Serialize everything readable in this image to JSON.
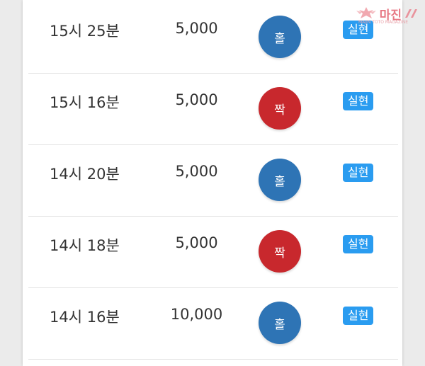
{
  "rows": [
    {
      "time": "15시 25분",
      "amount": "5,000",
      "result": "홀",
      "result_type": "odd",
      "status": "실현"
    },
    {
      "time": "15시 16분",
      "amount": "5,000",
      "result": "짝",
      "result_type": "even",
      "status": "실현"
    },
    {
      "time": "14시 20분",
      "amount": "5,000",
      "result": "홀",
      "result_type": "odd",
      "status": "실현"
    },
    {
      "time": "14시 18분",
      "amount": "5,000",
      "result": "짝",
      "result_type": "even",
      "status": "실현"
    },
    {
      "time": "14시 16분",
      "amount": "10,000",
      "result": "홀",
      "result_type": "odd",
      "status": "실현"
    }
  ],
  "watermark": {
    "text": "마진",
    "sub": "MAJIN TOTO MAGAZINE"
  },
  "colors": {
    "odd": "#2e74b5",
    "even": "#c8282d",
    "badge": "#2a9cf0"
  }
}
